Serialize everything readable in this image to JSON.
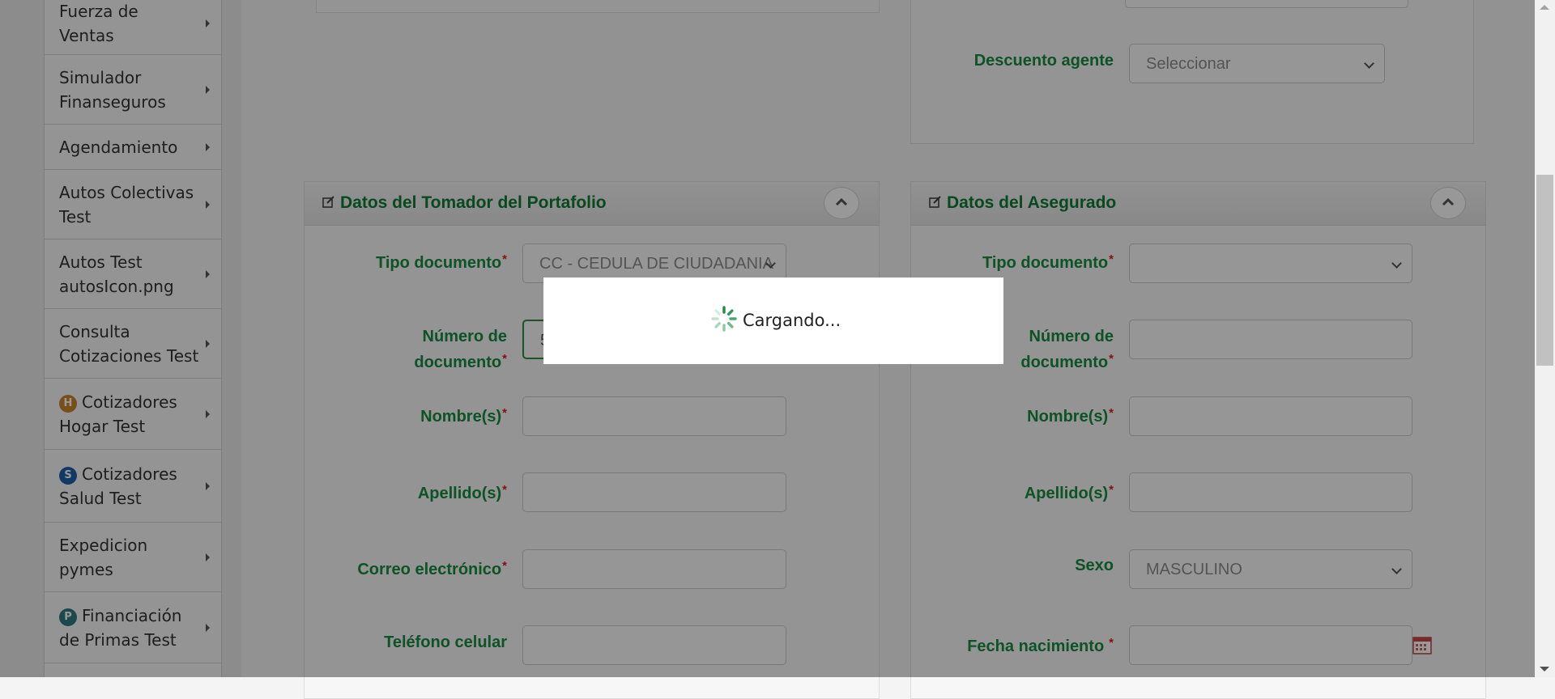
{
  "sidebar": {
    "items": [
      {
        "label_line1": "Fuerza de",
        "label_line2": "Ventas"
      },
      {
        "label_line1": "Simulador",
        "label_line2": "Finanseguros"
      },
      {
        "label_line1": "Agendamiento",
        "label_line2": ""
      },
      {
        "label_line1": "Autos Colectivas",
        "label_line2": "Test"
      },
      {
        "label_line1": "Autos Test",
        "label_line2": "autosIcon.png"
      },
      {
        "label_line1": "Consulta",
        "label_line2": "Cotizaciones Test"
      },
      {
        "label_line1": "Cotizadores",
        "label_line2": "Hogar Test",
        "icon": "H",
        "icon_color": "#c9822a"
      },
      {
        "label_line1": "Cotizadores",
        "label_line2": "Salud Test",
        "icon": "S",
        "icon_color": "#1f5fa8"
      },
      {
        "label_line1": "Expedicion",
        "label_line2": "pymes"
      },
      {
        "label_line1": "Financiación",
        "label_line2": "de Primas Test",
        "icon": "P",
        "icon_color": "#2f7b7f"
      }
    ]
  },
  "top_right": {
    "descuento_label": "Descuento agente",
    "descuento_value": "Seleccionar"
  },
  "tomador": {
    "title": "Datos del Tomador del Portafolio",
    "tipo_documento_label": "Tipo documento",
    "tipo_documento_value": "CC - CEDULA DE CIUDADANIA",
    "numero_label_1": "Número de",
    "numero_label_2": "documento",
    "numero_value": "5",
    "nombres_label": "Nombre(s)",
    "apellidos_label": "Apellido(s)",
    "correo_label": "Correo electrónico",
    "telefono_label": "Teléfono celular"
  },
  "asegurado": {
    "title": "Datos del Asegurado",
    "tipo_documento_label": "Tipo documento",
    "numero_label_1": "Número de",
    "numero_label_2": "documento",
    "nombres_label": "Nombre(s)",
    "apellidos_label": "Apellido(s)",
    "sexo_label": "Sexo",
    "sexo_value": "MASCULINO",
    "fecha_label": "Fecha nacimiento"
  },
  "required_mark": "*",
  "loading": {
    "text": "Cargando..."
  },
  "colors": {
    "label_green": "#168a3e",
    "title_green": "#0f7a33",
    "required_red": "#e01b1b"
  }
}
